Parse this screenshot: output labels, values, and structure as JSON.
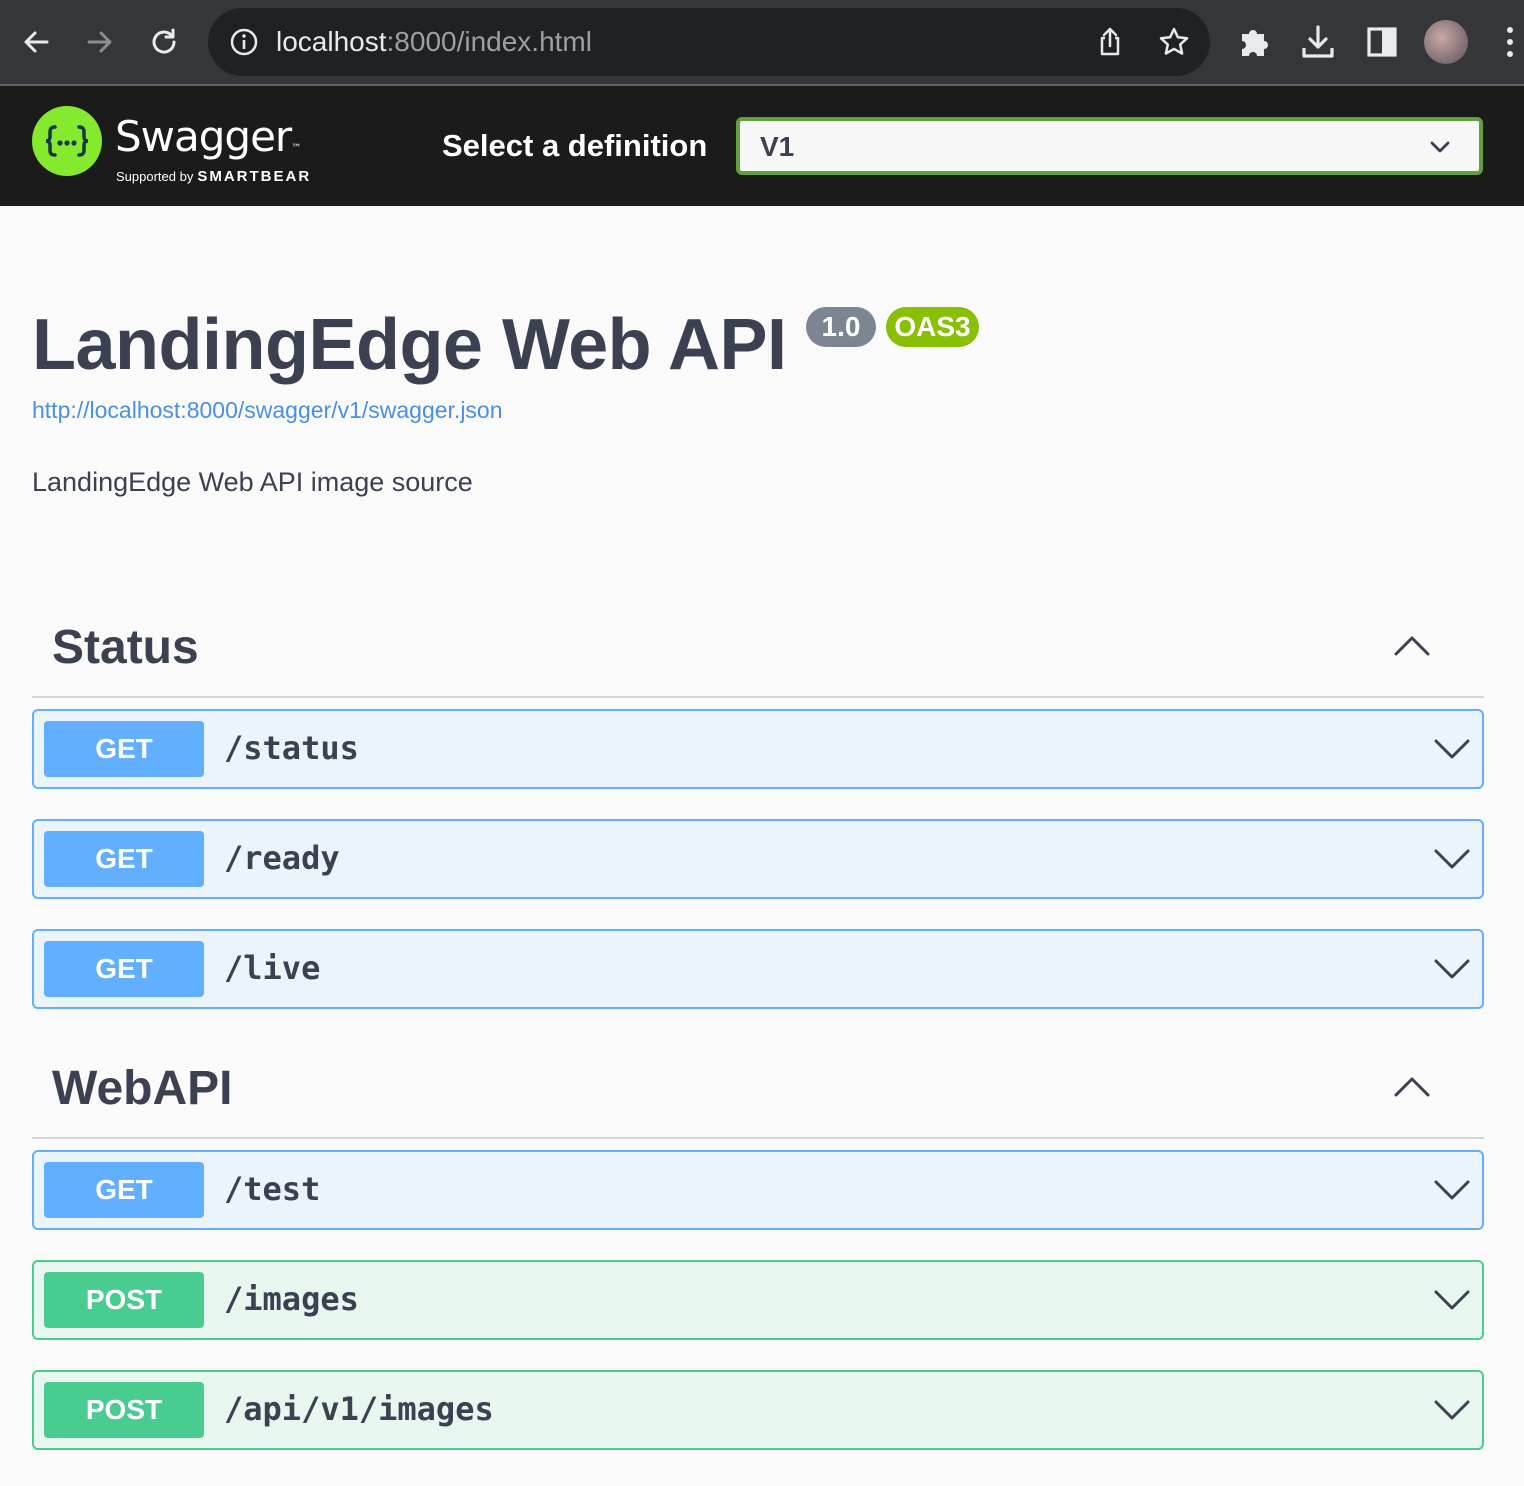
{
  "browser": {
    "url_host": "localhost",
    "url_rest": ":8000/index.html"
  },
  "topbar": {
    "logo_text": "Swagger",
    "logo_tm": "™",
    "logo_supported": "Supported by",
    "logo_brand": "SMARTBEAR",
    "definition_label": "Select a definition",
    "definition_value": "V1"
  },
  "info": {
    "title": "LandingEdge Web API",
    "version_badge": "1.0",
    "oas_badge": "OAS3",
    "spec_url": "http://localhost:8000/swagger/v1/swagger.json",
    "description": "LandingEdge Web API image source"
  },
  "tags": [
    {
      "name": "Status",
      "operations": [
        {
          "method": "GET",
          "path": "/status"
        },
        {
          "method": "GET",
          "path": "/ready"
        },
        {
          "method": "GET",
          "path": "/live"
        }
      ]
    },
    {
      "name": "WebAPI",
      "operations": [
        {
          "method": "GET",
          "path": "/test"
        },
        {
          "method": "POST",
          "path": "/images"
        },
        {
          "method": "POST",
          "path": "/api/v1/images"
        }
      ]
    }
  ],
  "colors": {
    "get": "#61affe",
    "post": "#49cc90",
    "swagger_green": "#85ea2d",
    "topbar": "#1b1b1b"
  },
  "icons": [
    "back-arrow-icon",
    "forward-arrow-icon",
    "reload-icon",
    "info-icon",
    "share-icon",
    "star-icon",
    "extensions-icon",
    "download-icon",
    "sidebar-icon",
    "more-icon",
    "chevron-down-icon",
    "chevron-up-icon"
  ]
}
